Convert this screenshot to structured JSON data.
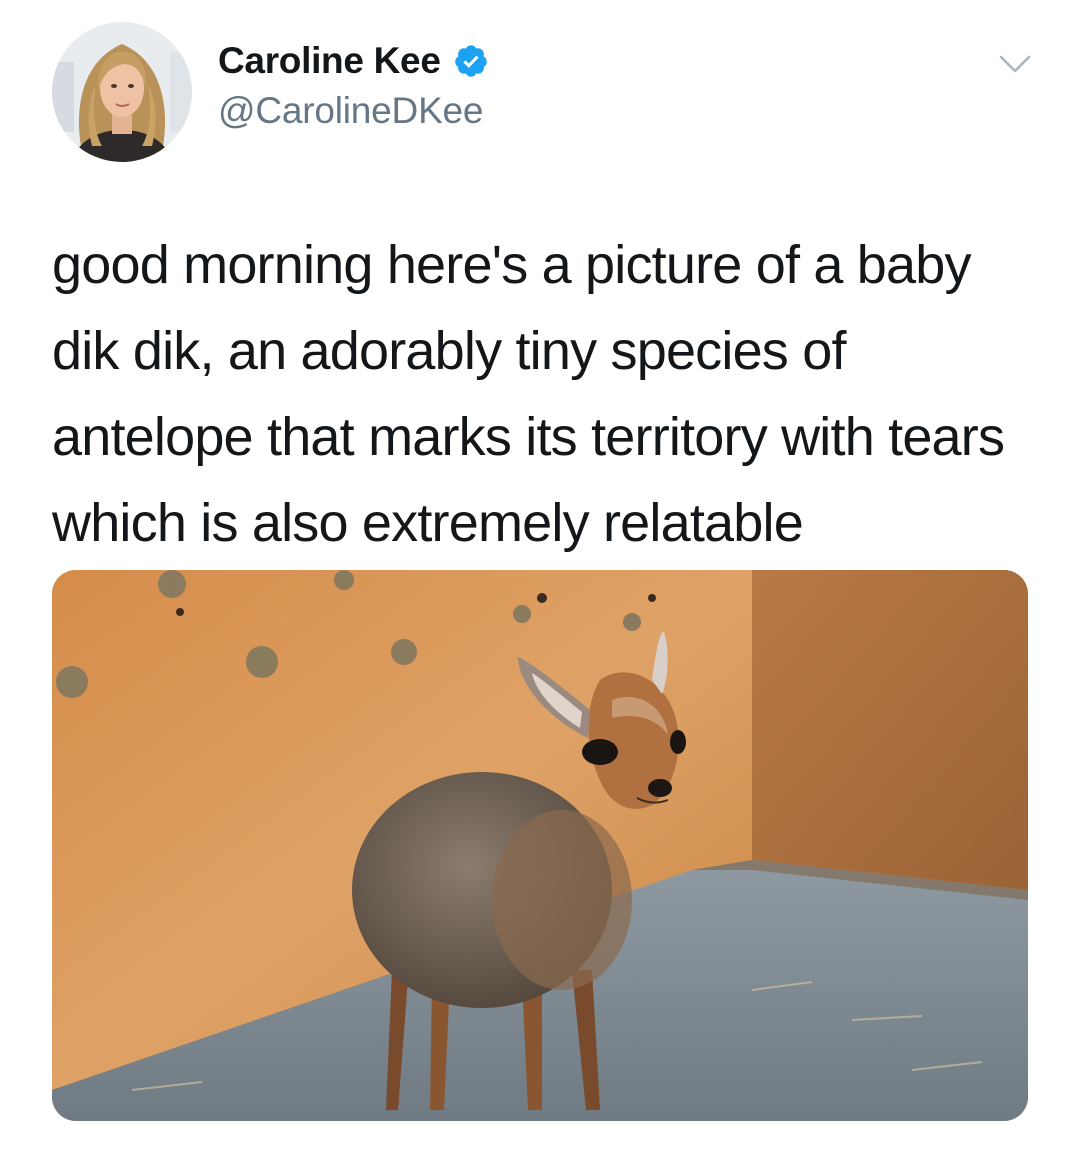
{
  "author": {
    "display_name": "Caroline Kee",
    "handle": "@CarolineDKee",
    "verified": true
  },
  "tweet": {
    "text": "good morning here's a picture of a baby dik dik, an adorably tiny species of antelope that marks its territory with tears which is also extremely relatable"
  },
  "icons": {
    "verified": "verified-badge-icon",
    "menu": "chevron-down-icon"
  },
  "colors": {
    "verified_blue": "#1da1f2",
    "handle_gray": "#657786",
    "text": "#14171a"
  }
}
